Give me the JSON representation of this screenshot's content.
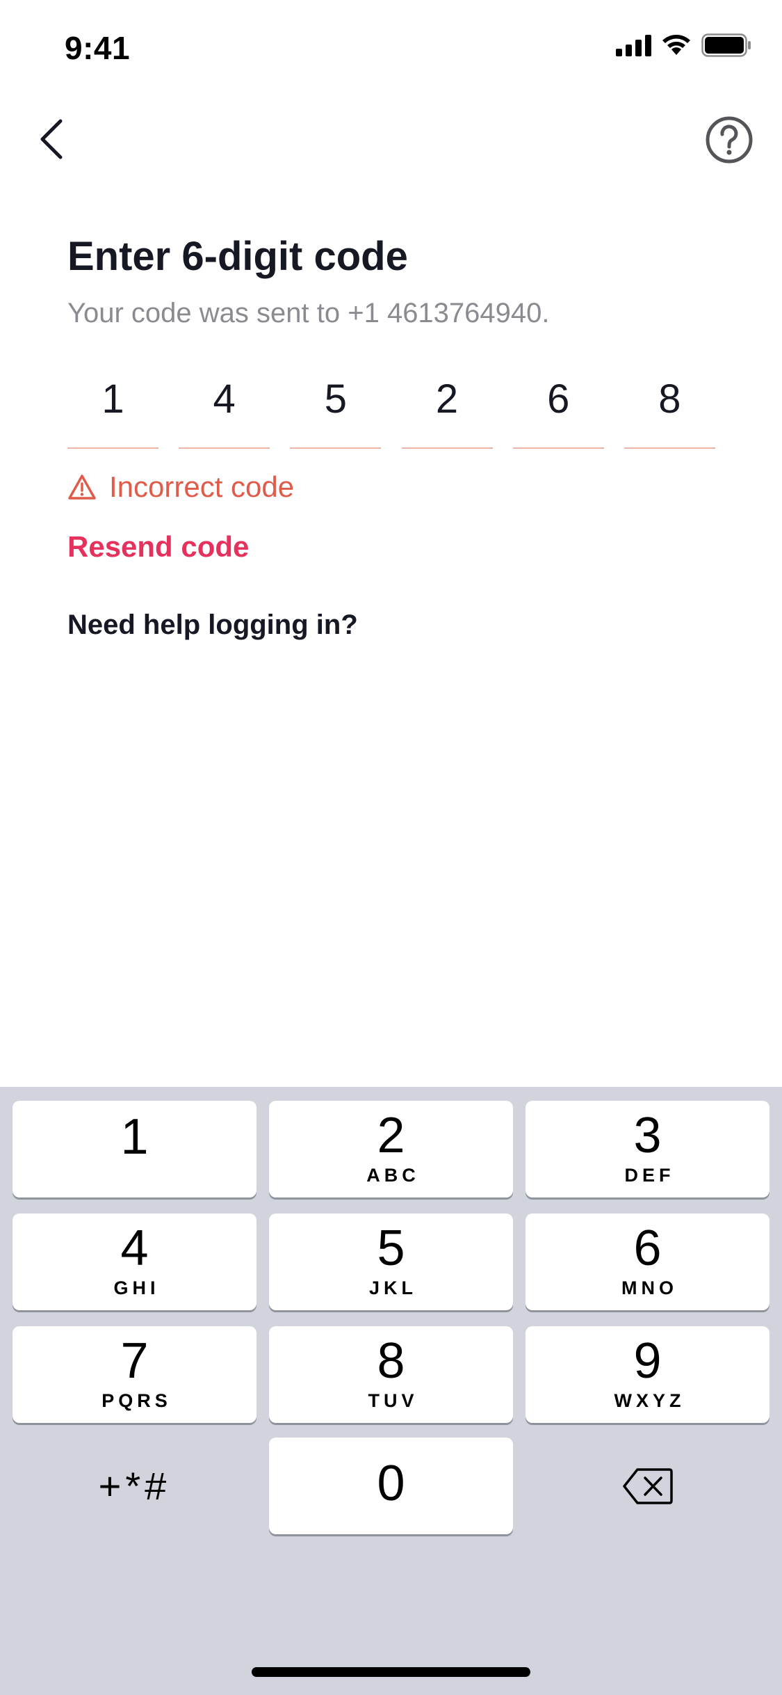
{
  "status_bar": {
    "time": "9:41"
  },
  "header": {
    "back_icon": "chevron-left-icon",
    "help_icon": "question-circle-icon"
  },
  "content": {
    "title": "Enter 6-digit code",
    "subtitle": "Your code was sent to +1 4613764940.",
    "code_digits": [
      "1",
      "4",
      "5",
      "2",
      "6",
      "8"
    ],
    "error_text": "Incorrect code",
    "resend_label": "Resend code",
    "help_label": "Need help logging in?"
  },
  "colors": {
    "error": "#e05b4a",
    "accent": "#e6315d",
    "text": "#161823",
    "muted": "#8a8b91",
    "keypad_bg": "#d1d4dc"
  },
  "keypad": {
    "keys": [
      {
        "num": "1",
        "letters": ""
      },
      {
        "num": "2",
        "letters": "ABC"
      },
      {
        "num": "3",
        "letters": "DEF"
      },
      {
        "num": "4",
        "letters": "GHI"
      },
      {
        "num": "5",
        "letters": "JKL"
      },
      {
        "num": "6",
        "letters": "MNO"
      },
      {
        "num": "7",
        "letters": "PQRS"
      },
      {
        "num": "8",
        "letters": "TUV"
      },
      {
        "num": "9",
        "letters": "WXYZ"
      },
      {
        "num": "0",
        "letters": ""
      }
    ],
    "symbols": "+*#",
    "delete_icon": "backspace-icon"
  }
}
